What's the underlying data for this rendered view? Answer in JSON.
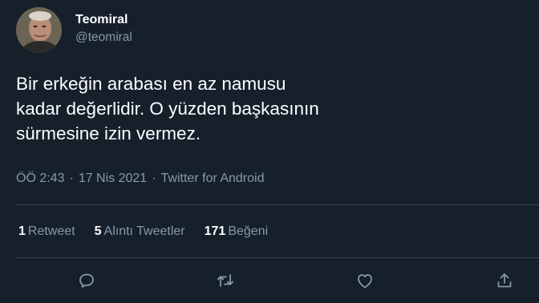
{
  "author": {
    "display_name": "Teomiral",
    "handle": "@teomiral"
  },
  "tweet": {
    "lines": [
      "Bir erkeğin arabası en az namusu",
      "kadar değerlidir. O yüzden başkasının",
      "sürmesine izin vermez."
    ]
  },
  "meta": {
    "time": "ÖÖ 2:43",
    "separator": "·",
    "date": "17 Nis 2021",
    "source": "Twitter for Android"
  },
  "stats": {
    "retweets": {
      "count": "1",
      "label": "Retweet"
    },
    "quotes": {
      "count": "5",
      "label": "Alıntı Tweetler"
    },
    "likes": {
      "count": "171",
      "label": "Beğeni"
    }
  },
  "actions": [
    "reply-icon",
    "retweet-icon",
    "like-icon",
    "share-icon"
  ],
  "colors": {
    "background": "#15202b",
    "text": "#ffffff",
    "secondary_text": "#8899a6",
    "divider": "#38444d"
  }
}
